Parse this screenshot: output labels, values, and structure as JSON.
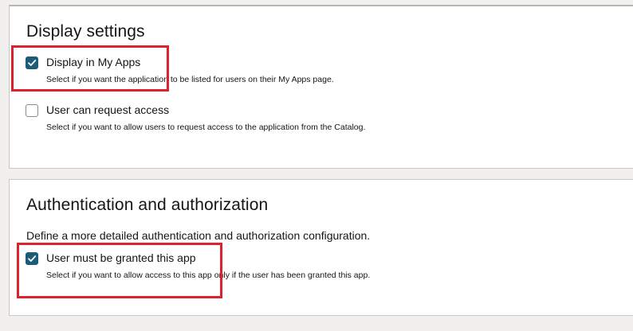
{
  "display_settings": {
    "title": "Display settings",
    "options": [
      {
        "label": "Display in My Apps",
        "help": "Select if you want the application to be listed for users on their My Apps page.",
        "checked": true
      },
      {
        "label": "User can request access",
        "help": "Select if you want to allow users to request access to the application from the Catalog.",
        "checked": false
      }
    ]
  },
  "auth": {
    "title": "Authentication and authorization",
    "description": "Define a more detailed authentication and authorization configuration.",
    "options": [
      {
        "label": "User must be granted this app",
        "help": "Select if you want to allow access to this app only if the user has been granted this app.",
        "checked": true
      }
    ]
  },
  "colors": {
    "checkbox_checked": "#1b5d79",
    "highlight": "#e0202b",
    "page_background": "#f1f0ef"
  }
}
